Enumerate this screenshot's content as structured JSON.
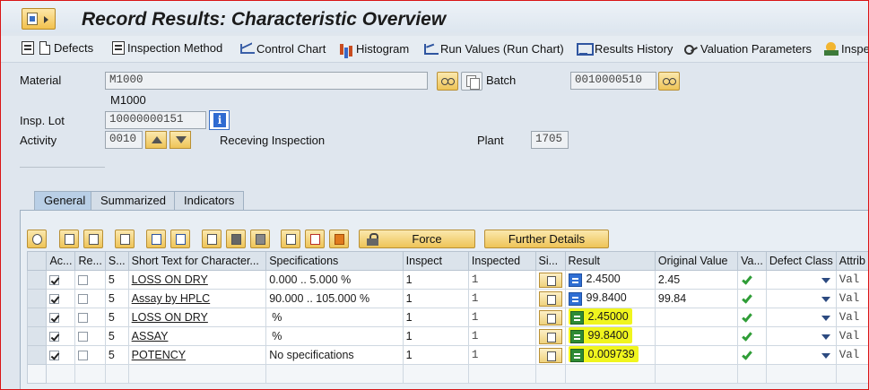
{
  "title": "Record Results: Characteristic Overview",
  "toolbar": {
    "defects": "Defects",
    "inspection_method": "Inspection Method",
    "control_chart": "Control Chart",
    "histogram": "Histogram",
    "run_values": "Run Values (Run Chart)",
    "results_history": "Results History",
    "valuation_parameters": "Valuation Parameters",
    "inspe": "Inspe"
  },
  "header": {
    "material_label": "Material",
    "material_value": "M1000",
    "material_text": "M1000",
    "batch_label": "Batch",
    "batch_value": "0010000510",
    "insp_lot_label": "Insp. Lot",
    "insp_lot_value": "10000000151",
    "activity_label": "Activity",
    "activity_value": "0010",
    "activity_text": "Receving Inspection",
    "plant_label": "Plant",
    "plant_value": "1705"
  },
  "tabs": [
    "General",
    "Summarized",
    "Indicators"
  ],
  "buttons": {
    "force": "Force",
    "further_details": "Further Details"
  },
  "columns": [
    "Ac...",
    "Re...",
    "S...",
    "Short Text for Character...",
    "Specifications",
    "Inspect",
    "Inspected",
    "Si...",
    "Result",
    "Original Value",
    "Va...",
    "Defect Class",
    "Attrib"
  ],
  "rows": [
    {
      "active": true,
      "req": false,
      "s": "5",
      "text": "LOSS ON DRY",
      "spec": "0.000 .. 5.000 %",
      "inspect": "1",
      "inspected": "1",
      "result": "2.4500",
      "original": "2.45",
      "highlight": false,
      "attrib": "Val"
    },
    {
      "active": true,
      "req": false,
      "s": "5",
      "text": "Assay by HPLC",
      "spec": "90.000 .. 105.000 %",
      "inspect": "1",
      "inspected": "1",
      "result": "99.8400",
      "original": "99.84",
      "highlight": false,
      "attrib": "Val"
    },
    {
      "active": true,
      "req": false,
      "s": "5",
      "text": "LOSS ON DRY",
      "spec": "%",
      "inspect": "1",
      "inspected": "1",
      "result": "2.45000",
      "original": "",
      "highlight": true,
      "attrib": "Val"
    },
    {
      "active": true,
      "req": false,
      "s": "5",
      "text": "ASSAY",
      "spec": "%",
      "inspect": "1",
      "inspected": "1",
      "result": "99.8400",
      "original": "",
      "highlight": true,
      "attrib": "Val"
    },
    {
      "active": true,
      "req": false,
      "s": "5",
      "text": "POTENCY",
      "spec": "No specifications",
      "inspect": "1",
      "inspected": "1",
      "result": "0.009739",
      "original": "",
      "highlight": true,
      "attrib": "Val"
    }
  ],
  "colors": {
    "highlight": "#f0f51e",
    "valuation_ok": "#2f9d37",
    "result_icon_blue": "#2f6ed3",
    "result_icon_green": "#2e8b35"
  }
}
